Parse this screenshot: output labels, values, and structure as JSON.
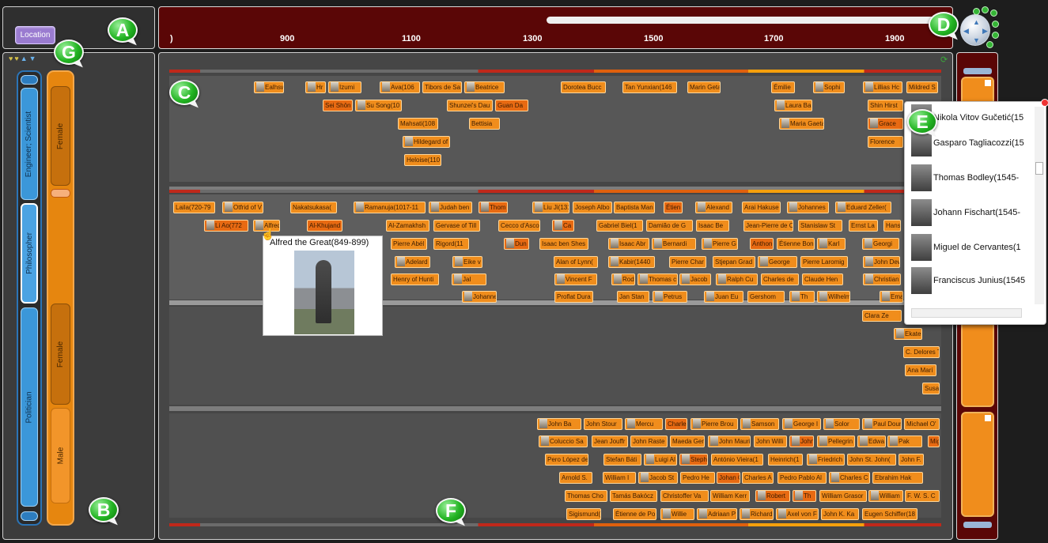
{
  "location_button": "Location",
  "timeline": {
    "ticks": [
      ")",
      "900",
      "1100",
      "1300",
      "1500",
      "1700",
      "1900"
    ]
  },
  "markers": [
    "A",
    "B",
    "C",
    "D",
    "E",
    "F",
    "G"
  ],
  "facets": {
    "occupation": [
      "Engineer; Scientist",
      "Philosopher",
      "Politician"
    ],
    "gender": [
      "Female",
      "Female",
      "Male"
    ]
  },
  "icons": {
    "filter": [
      "filter-yellow-icon",
      "filter-yellow-icon",
      "up-arrow-icon",
      "down-arrow-icon"
    ],
    "refresh": "refresh-icon"
  },
  "band1_cards": [
    "Ealhsw",
    "Hr",
    "Izumi",
    "Ava(106",
    "Tibors de Sa",
    "Beatrice",
    "Dorotea Bucc",
    "Tan Yunxian(146",
    "Marin Geta",
    "Émilie",
    "Sophi",
    "Lillias Hc",
    "Mildred S",
    "Sei Shōn",
    "Su Song(10",
    "Shunzei's Dau",
    "Guan Da",
    "Laura Ba",
    "Shin Hirst",
    "Mahsati(108",
    "Bettisia",
    "Maria Gaeta",
    "Grace",
    "Hildegard of",
    "Florence",
    "Heloise(110"
  ],
  "band2_cards": [
    "Laila(720-79",
    "Otfrid of V",
    "Nakatsukasa(",
    "Ramanuja(1017-11",
    "Judah ben",
    "Thom",
    "Liu Ji(131",
    "Joseph Albo",
    "Baptista Man",
    "Étien",
    "Alexand",
    "Arai Hakuse",
    "Johannes",
    "Eduard Zeller(",
    "Li Ao(772",
    "Alfred",
    "Al-Khujand",
    "Al-Zamakhsh",
    "Gervase of Till",
    "Cecco d'Asco",
    "Ca",
    "Gabriel Biel(1",
    "Damião de G",
    "Isaac Be",
    "Jean-Pierre de C",
    "Stanislaw St",
    "Ernst La",
    "Hans",
    "Pierre Abél",
    "Rigord(11",
    "Dun",
    "Isaac ben Shes",
    "Isaac Abr",
    "Bernardi",
    "Pierre G",
    "Anthon",
    "Étienne Bon",
    "Karl",
    "Georgi",
    "Adelard c",
    "Eike v",
    "Alan of Lynn(",
    "Kabir(1440",
    "Pierre Char",
    "Stjepan Grad",
    "George",
    "Pierre Laromig",
    "John Dew",
    "Henry of Hunti",
    "Jal",
    "Vincent F",
    "Rod",
    "Thomas c",
    "Jacob",
    "Ralph Cu",
    "Charles de",
    "Claude Hen",
    "Christian",
    "Johanne",
    "Proflat Dura",
    "Jan Stan",
    "Petrus",
    "Juan Eu",
    "Gershom",
    "Th",
    "Wilhelm",
    "Ema"
  ],
  "band3_cards": [
    "Clara Ze",
    "Ekaterin",
    "C. Delores T",
    "Ana Marí",
    "Susan"
  ],
  "band4_cards": [
    "John Ba",
    "John Stour",
    "Mercu",
    "Charle",
    "Pierre Brou",
    "Samson",
    "George I",
    "Solor",
    "Paul Doum",
    "Michael O'",
    "Coluccio Sa",
    "Jean Jouffr",
    "John Raste",
    "Maeda Gen",
    "John Mauri",
    "John Willi",
    "John",
    "Pellegrin",
    "Edwa",
    "Pak",
    "Mig",
    "Pero López de",
    "Stefan Báti",
    "Luigi Al",
    "Steph",
    "António Vieira(1",
    "Heinrich(1",
    "Friedrich",
    "John St. John(",
    "John F.",
    "Arnold S.",
    "William I",
    "Jacob St",
    "Pedro He",
    "Johan C",
    "Charles A",
    "Pedro Pablo Al",
    "Charles C",
    "Ebrahim Hak",
    "Thomas Cho",
    "Tamás Bakócz",
    "Christoffer Va",
    "William Kerr",
    "Robert",
    "Th",
    "William Grasor",
    "William",
    "F. W. S. C",
    "Sigismund(1",
    "Étienne de Po",
    "Willie",
    "Adriaan P",
    "Richard",
    "Axel von F",
    "John K. Ka",
    "Eugen Schiffer(18"
  ],
  "tooltip": {
    "title": "Alfred the Great(849-899)"
  },
  "popup_list": [
    "Nikola Vitov Gučetić(15",
    "Gasparo Tagliacozzi(15",
    "Thomas Bodley(1545-",
    "Johann Fischart(1545-",
    "Miguel de Cervantes(1",
    "Franciscus Junius(1545"
  ]
}
